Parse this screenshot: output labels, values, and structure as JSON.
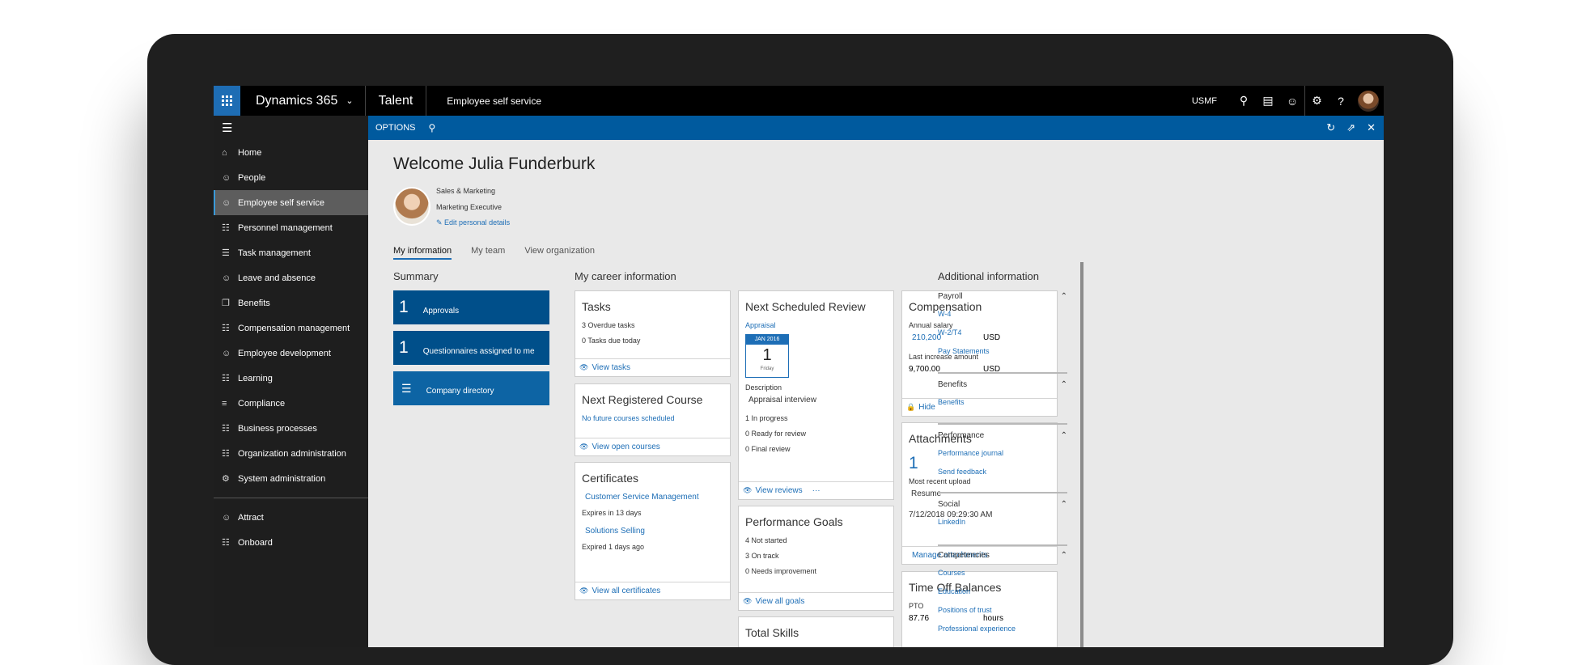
{
  "topbar": {
    "brand": "Dynamics 365",
    "app": "Talent",
    "area": "Employee self service",
    "company": "USMF",
    "icons": [
      "search-icon",
      "message-icon",
      "smiley-icon",
      "gear-icon",
      "help-icon"
    ]
  },
  "sidebar": {
    "items": [
      {
        "label": "Home",
        "icon": "home-icon"
      },
      {
        "label": "People",
        "icon": "people-icon"
      },
      {
        "label": "Employee self service",
        "icon": "self-service-icon"
      },
      {
        "label": "Personnel management",
        "icon": "personnel-icon"
      },
      {
        "label": "Task management",
        "icon": "task-icon"
      },
      {
        "label": "Leave and absence",
        "icon": "leave-icon"
      },
      {
        "label": "Benefits",
        "icon": "benefits-icon"
      },
      {
        "label": "Compensation management",
        "icon": "compensation-icon"
      },
      {
        "label": "Employee development",
        "icon": "development-icon"
      },
      {
        "label": "Learning",
        "icon": "learning-icon"
      },
      {
        "label": "Compliance",
        "icon": "compliance-icon"
      },
      {
        "label": "Business processes",
        "icon": "business-icon"
      },
      {
        "label": "Organization administration",
        "icon": "org-icon"
      },
      {
        "label": "System administration",
        "icon": "system-icon"
      }
    ],
    "bottom_items": [
      {
        "label": "Attract",
        "icon": "attract-icon"
      },
      {
        "label": "Onboard",
        "icon": "onboard-icon"
      }
    ]
  },
  "options_bar": {
    "label": "OPTIONS"
  },
  "welcome": "Welcome Julia Funderburk",
  "profile": {
    "department": "Sales & Marketing",
    "job_title": "Marketing Executive",
    "edit_label": "Edit personal details"
  },
  "tabs": [
    "My information",
    "My team",
    "View organization"
  ],
  "summary": {
    "title": "Summary",
    "approvals_count": "1",
    "approvals_label": "Approvals",
    "questionnaires_count": "1",
    "questionnaires_label": "Questionnaires assigned to me",
    "directory_label": "Company directory"
  },
  "career": {
    "title": "My career information",
    "tasks": {
      "title": "Tasks",
      "line1": "3 Overdue tasks",
      "line2": "0 Tasks due today",
      "footer": "View tasks"
    },
    "course": {
      "title": "Next Registered Course",
      "line1": "No future courses scheduled",
      "footer": "View open courses"
    },
    "certificates": {
      "title": "Certificates",
      "cert1": "Customer Service Management",
      "cert1_status": "Expires in 13 days",
      "cert2": "Solutions Selling",
      "cert2_status": "Expired 1 days ago",
      "footer": "View all certificates"
    },
    "review": {
      "title": "Next Scheduled Review",
      "type": "Appraisal",
      "cal_month": "JAN 2016",
      "cal_day": "1",
      "cal_weekday": "Friday",
      "desc_label": "Description",
      "desc_value": "Appraisal interview",
      "line1": "1 In progress",
      "line2": "0 Ready for review",
      "line3": "0 Final review",
      "footer": "View reviews",
      "more": "···"
    },
    "goals": {
      "title": "Performance Goals",
      "line1": "4 Not started",
      "line2": "3 On track",
      "line3": "0 Needs improvement",
      "footer": "View all goals"
    },
    "skills": {
      "title": "Total Skills"
    },
    "compensation": {
      "title": "Compensation",
      "salary_label": "Annual salary",
      "salary_value": "210,200",
      "salary_currency": "USD",
      "increase_label": "Last increase amount",
      "increase_value": "9,700.00",
      "increase_currency": "USD",
      "footer": "Hide"
    },
    "attachments": {
      "title": "Attachments",
      "count": "1",
      "recent_label": "Most recent upload",
      "recent_value": "Resume",
      "timestamp": "7/12/2018 09:29:30 AM",
      "footer": "Manage attachments"
    },
    "timeoff": {
      "title": "Time Off Balances",
      "type": "PTO",
      "value": "87.76",
      "unit": "hours"
    }
  },
  "additional": {
    "title": "Additional information",
    "groups": [
      {
        "title": "Payroll",
        "links": [
          "W-4",
          "W-2/T4",
          "Pay Statements"
        ]
      },
      {
        "title": "Benefits",
        "links": [
          "Benefits"
        ]
      },
      {
        "title": "Performance",
        "links": [
          "Performance journal",
          "Send feedback"
        ]
      },
      {
        "title": "Social",
        "links": [
          "LinkedIn"
        ]
      },
      {
        "title": "Competencies",
        "links": [
          "Courses",
          "Education",
          "Positions of trust",
          "Professional experience"
        ]
      }
    ]
  }
}
